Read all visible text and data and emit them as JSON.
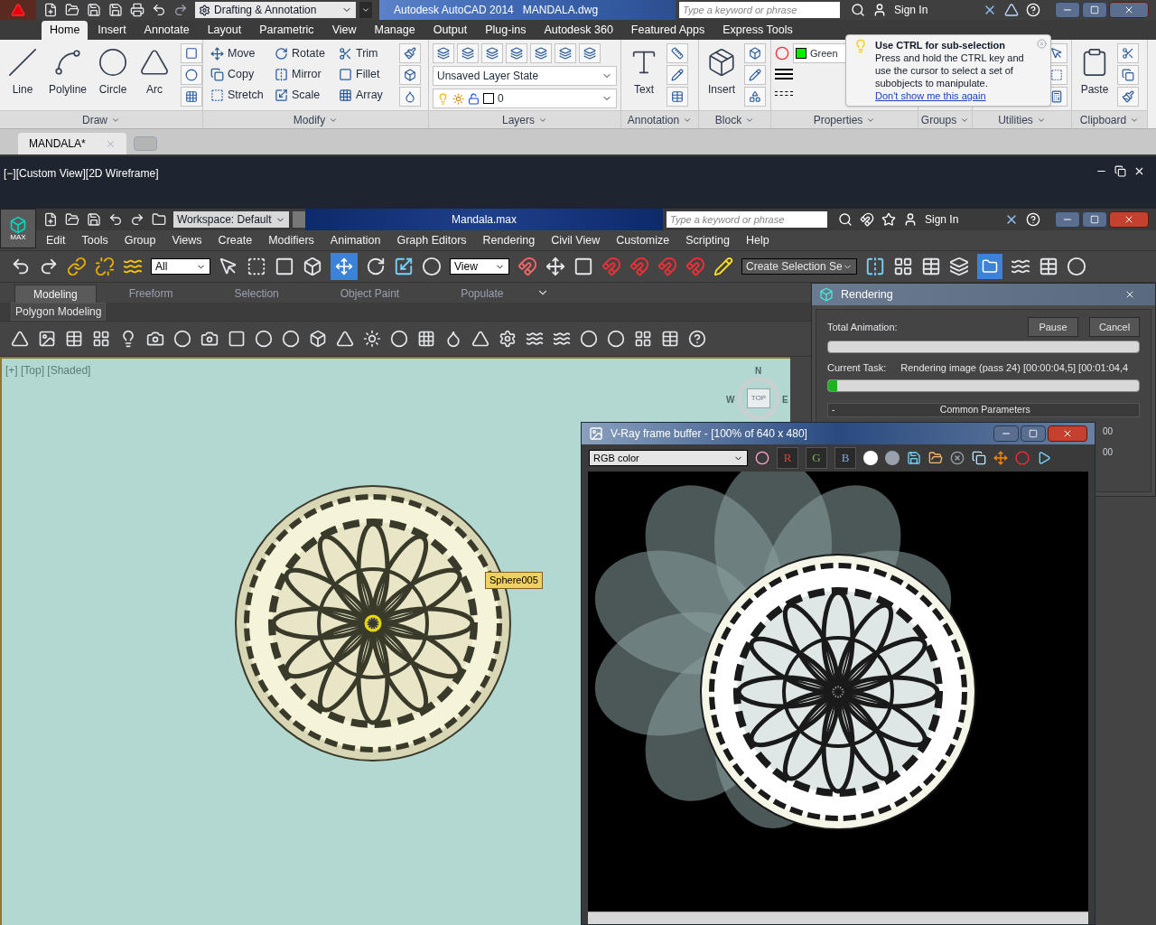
{
  "autocad": {
    "workspace": "Drafting & Annotation",
    "title": "Autodesk AutoCAD 2014   MANDALA.dwg",
    "search": {
      "placeholder": "Type a keyword or phrase"
    },
    "sign_in": "Sign In",
    "tabs": [
      {
        "label": "Home",
        "selected": true
      },
      {
        "label": "Insert",
        "selected": false
      },
      {
        "label": "Annotate",
        "selected": false
      },
      {
        "label": "Layout",
        "selected": false
      },
      {
        "label": "Parametric",
        "selected": false
      },
      {
        "label": "View",
        "selected": false
      },
      {
        "label": "Manage",
        "selected": false
      },
      {
        "label": "Output",
        "selected": false
      },
      {
        "label": "Plug-ins",
        "selected": false
      },
      {
        "label": "Autodesk 360",
        "selected": false
      },
      {
        "label": "Featured Apps",
        "selected": false
      },
      {
        "label": "Express Tools",
        "selected": false
      }
    ],
    "panels": [
      {
        "kind": "draw",
        "title": "Draw",
        "tools": [
          "Line",
          "Polyline",
          "Circle",
          "Arc"
        ]
      },
      {
        "kind": "modify",
        "title": "Modify",
        "tools": [
          "Move",
          "Rotate",
          "Trim",
          "Copy",
          "Mirror",
          "Fillet",
          "Stretch",
          "Scale",
          "Array"
        ]
      },
      {
        "kind": "layers",
        "title": "Layers",
        "layer_state": "Unsaved Layer State",
        "layer": "0"
      },
      {
        "kind": "annotation",
        "title": "Annotation",
        "tool": "Text"
      },
      {
        "kind": "block",
        "title": "Block",
        "tool": "Insert"
      },
      {
        "kind": "properties",
        "title": "Properties",
        "color_name": "Green"
      },
      {
        "kind": "groups",
        "title": "Groups"
      },
      {
        "kind": "utilities",
        "title": "Utilities"
      },
      {
        "kind": "clipboard",
        "title": "Clipboard",
        "tool": "Paste"
      }
    ],
    "tooltip": {
      "title": "Use CTRL for sub-selection",
      "body": "Press and hold the CTRL key and use the cursor to select a set of subobjects to manipulate.",
      "link": "Don't show me this again"
    },
    "document_tabs": [
      {
        "label": "MANDALA*",
        "selected": true
      }
    ],
    "viewport_label": "[−][Custom View][2D Wireframe]"
  },
  "max": {
    "logo": "MAX",
    "workspace": "Workspace: Default",
    "title": "Mandala.max",
    "search": {
      "placeholder": "Type a keyword or phrase"
    },
    "sign_in": "Sign In",
    "menu": [
      "Edit",
      "Tools",
      "Group",
      "Views",
      "Create",
      "Modifiers",
      "Animation",
      "Graph Editors",
      "Rendering",
      "Civil View",
      "Customize",
      "Scripting",
      "Help"
    ],
    "selection_filter": "All",
    "reference_coordinate": "View",
    "named_selection": "Create Selection Se",
    "ribbon_tabs": [
      {
        "label": "Modeling",
        "selected": true
      },
      {
        "label": "Freeform",
        "selected": false
      },
      {
        "label": "Selection",
        "selected": false
      },
      {
        "label": "Object Paint",
        "selected": false
      },
      {
        "label": "Populate",
        "selected": false
      }
    ],
    "ribbon_panel": "Polygon Modeling",
    "viewport": {
      "label": "[+] [Top] [Shaded]",
      "object_tooltip": "Sphere005",
      "viewcube": "TOP",
      "compass": [
        "N",
        "W",
        "E"
      ]
    }
  },
  "rendering": {
    "title": "Rendering",
    "total_label": "Total Animation:",
    "total": {
      "level": 0
    },
    "buttons": [
      "Pause",
      "Cancel"
    ],
    "task_label": "Current Task:",
    "task": "Rendering image (pass 24) [00:00:04,5] [00:01:04,4",
    "task_progress": {
      "level": 0.03
    },
    "rollout": {
      "toggle": "-",
      "title": "Common Parameters"
    },
    "column_values": [
      "00",
      "00"
    ]
  },
  "vray": {
    "title": "V-Ray frame buffer - [100% of 640 x 480]",
    "channel": "RGB color",
    "channels": [
      "R",
      "G",
      "B"
    ]
  }
}
